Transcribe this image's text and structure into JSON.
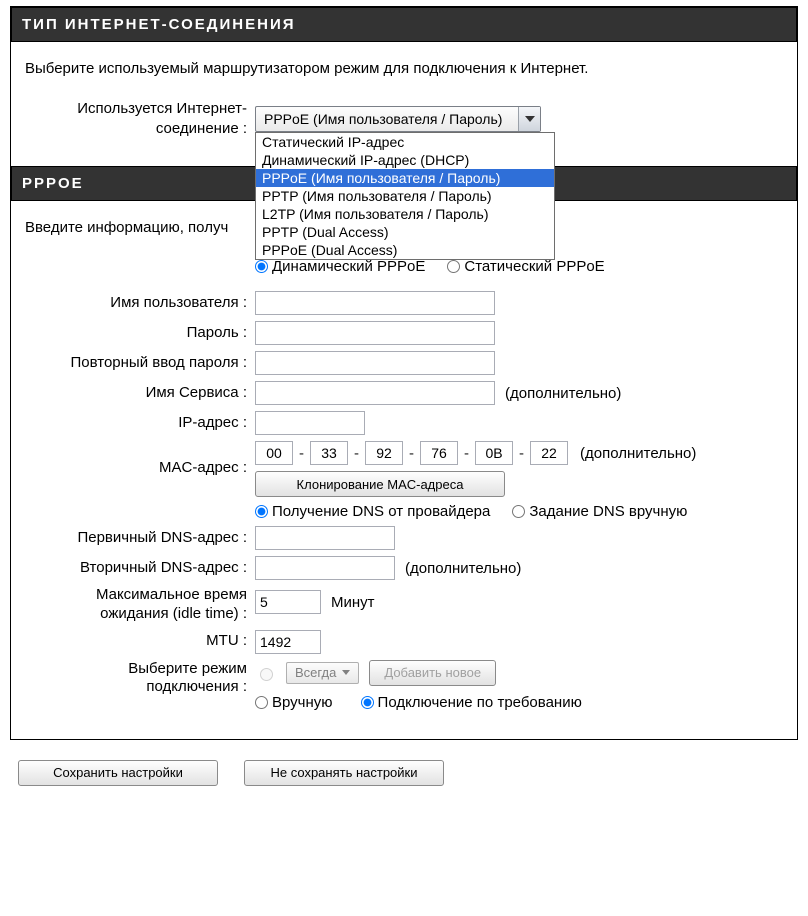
{
  "section1": {
    "title": "ТИП ИНТЕРНЕТ-СОЕДИНЕНИЯ",
    "intro": "Выберите используемый маршрутизатором режим для подключения к Интернет.",
    "combo_label": "Используется Интернет-соединение :",
    "combo_selected": "PPPoE (Имя пользователя / Пароль)",
    "combo_options": [
      "Статический IP-адрес",
      "Динамический IP-адрес (DHCP)",
      "PPPoE (Имя пользователя / Пароль)",
      "PPTP (Имя пользователя / Пароль)",
      "L2TP (Имя пользователя / Пароль)",
      "PPTP (Dual Access)",
      "PPPoE (Dual Access)"
    ],
    "combo_selected_index": 2
  },
  "section2": {
    "title": "PPPOE",
    "intro_visible": "Введите информацию, получ",
    "mode": {
      "dyn": "Динамический PPPoE",
      "stat": "Статический PPPoE"
    },
    "labels": {
      "user": "Имя пользователя :",
      "pass": "Пароль :",
      "pass2": "Повторный ввод пароля :",
      "svc": "Имя Сервиса :",
      "ip": "IP-адрес :",
      "mac": "MAC-адрес :",
      "dns1": "Первичный DNS-адрес :",
      "dns2": "Вторичный DNS-адрес :",
      "idle1": "Максимальное время",
      "idle2": "ожидания (idle time) :",
      "mtu": "MTU :",
      "connmode1": "Выберите режим",
      "connmode2": "подключения :"
    },
    "optional_note": "(дополнительно)",
    "mac_vals": [
      "00",
      "33",
      "92",
      "76",
      "0B",
      "22"
    ],
    "clone_btn": "Клонирование MAC-адреса",
    "dns_mode": {
      "auto": "Получение DNS от провайдера",
      "manual": "Задание DNS вручную"
    },
    "idle_value": "5",
    "idle_unit": "Минут",
    "mtu_value": "1492",
    "conn": {
      "always": "Всегда",
      "addnew": "Добавить новое",
      "manual": "Вручную",
      "ondemand": "Подключение по требованию"
    }
  },
  "footer": {
    "save": "Сохранить настройки",
    "nosave": "Не сохранять настройки"
  }
}
